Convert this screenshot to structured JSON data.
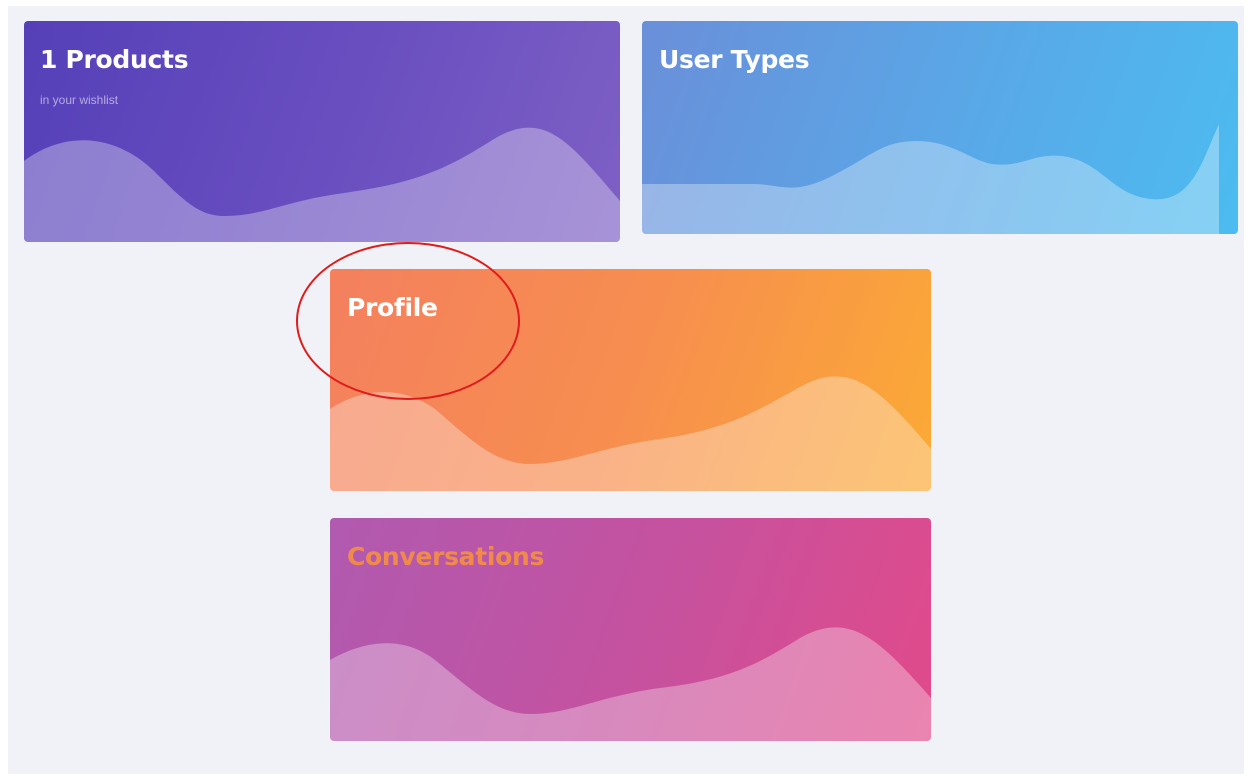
{
  "cards": {
    "products": {
      "title": "1 Products",
      "subtitle": "in your wishlist"
    },
    "user_types": {
      "title": "User Types"
    },
    "profile": {
      "title": "Profile"
    },
    "conversations": {
      "title": "Conversations",
      "title_color": "#f08a4b"
    }
  },
  "annotation": {
    "color": "#e01b1b"
  }
}
